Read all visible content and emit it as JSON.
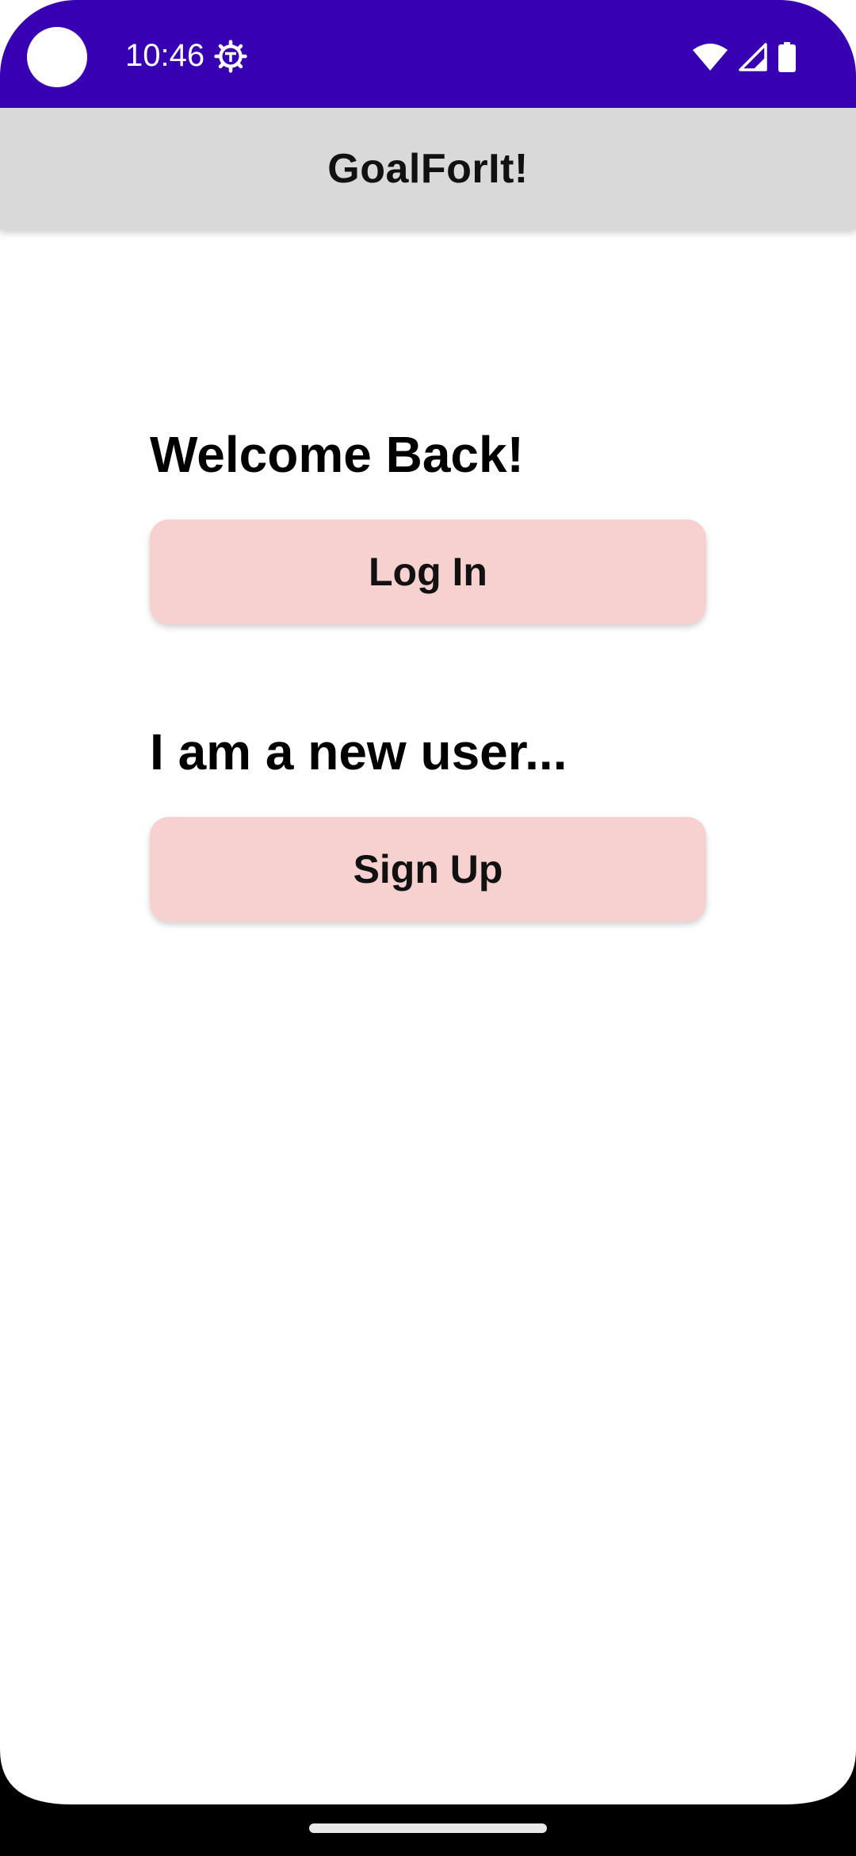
{
  "status_bar": {
    "time": "10:46",
    "icons": [
      "settings-icon",
      "wifi-icon",
      "cellular-signal-icon",
      "battery-icon"
    ],
    "background_color": "#3700b3"
  },
  "app_bar": {
    "title": "GoalForIt!",
    "background_color": "#d9d9d9"
  },
  "main": {
    "welcome_heading": "Welcome Back!",
    "login_button_label": "Log In",
    "new_user_heading": "I am a new user...",
    "signup_button_label": "Sign Up",
    "button_color": "#f6d1d0"
  },
  "nav_bar": {
    "icons": [
      "home-handle-icon"
    ]
  }
}
